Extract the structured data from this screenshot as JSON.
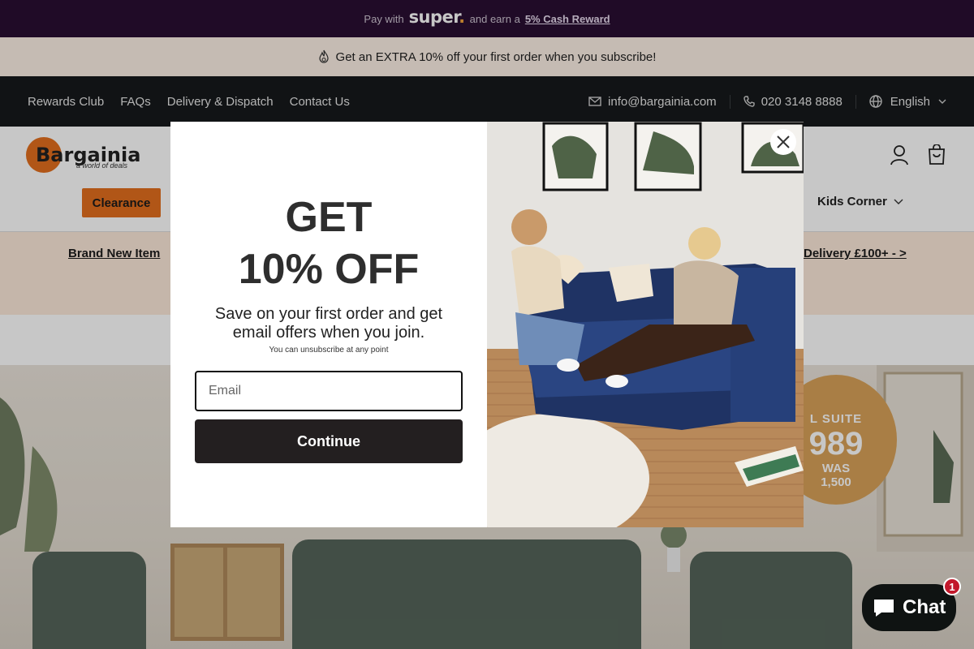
{
  "paybar": {
    "prefix": "Pay with",
    "brand": "super",
    "middle": "and earn a",
    "reward": "5% Cash Reward"
  },
  "promobar": {
    "icon": "flame-icon",
    "text": "Get an EXTRA 10% off your first order when you subscribe!"
  },
  "topnav": {
    "links": [
      "Rewards Club",
      "FAQs",
      "Delivery & Dispatch",
      "Contact Us"
    ],
    "email": "info@bargainia.com",
    "phone": "020 3148 8888",
    "language": "English"
  },
  "header": {
    "logo_text": "Bargainia",
    "logo_tagline": "a world of deals",
    "clearance_label": "Clearance",
    "kids_label": "Kids Corner"
  },
  "strip": {
    "left_text": "Brand New Item",
    "right_text": "Delivery £100+ - >"
  },
  "hero": {
    "badge_line1": "L SUITE",
    "badge_price": "989",
    "badge_was": "WAS",
    "badge_old": "1,500"
  },
  "modal": {
    "heading_line1": "GET",
    "heading_line2": "10% OFF",
    "subtitle": "Save on your first order and get email offers when you join.",
    "fine_print": "You can unsubscribe at any point",
    "email_placeholder": "Email",
    "continue_label": "Continue"
  },
  "chat": {
    "label": "Chat",
    "unread": "1"
  },
  "colors": {
    "accent": "#e36f1e",
    "paybar_bg": "#2a0f33",
    "nav_bg": "#16191b",
    "sofa_navy": "#233a70"
  }
}
